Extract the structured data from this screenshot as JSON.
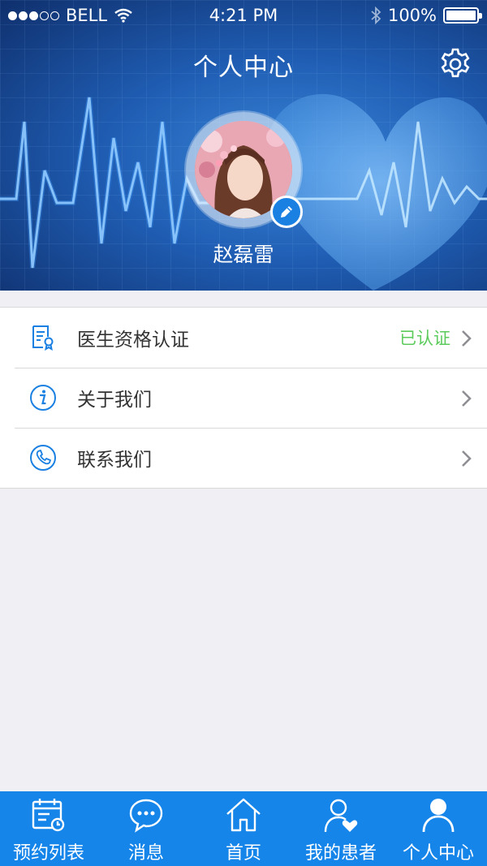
{
  "status_bar": {
    "carrier": "BELL",
    "time": "4:21 PM",
    "battery": "100%"
  },
  "header": {
    "title": "个人中心",
    "username": "赵磊雷"
  },
  "menu": {
    "items": [
      {
        "label": "医生资格认证",
        "status": "已认证",
        "icon": "certificate-icon"
      },
      {
        "label": "关于我们",
        "icon": "info-icon"
      },
      {
        "label": "联系我们",
        "icon": "phone-icon"
      }
    ]
  },
  "tabbar": {
    "items": [
      {
        "label": "预约列表",
        "icon": "calendar-icon"
      },
      {
        "label": "消息",
        "icon": "chat-bubble-icon"
      },
      {
        "label": "首页",
        "icon": "home-icon"
      },
      {
        "label": "我的患者",
        "icon": "patient-heart-icon"
      },
      {
        "label": "个人中心",
        "icon": "person-icon",
        "active": true
      }
    ]
  },
  "colors": {
    "accent": "#1685ea",
    "verified": "#5ccb5c",
    "background": "#efeff4"
  }
}
